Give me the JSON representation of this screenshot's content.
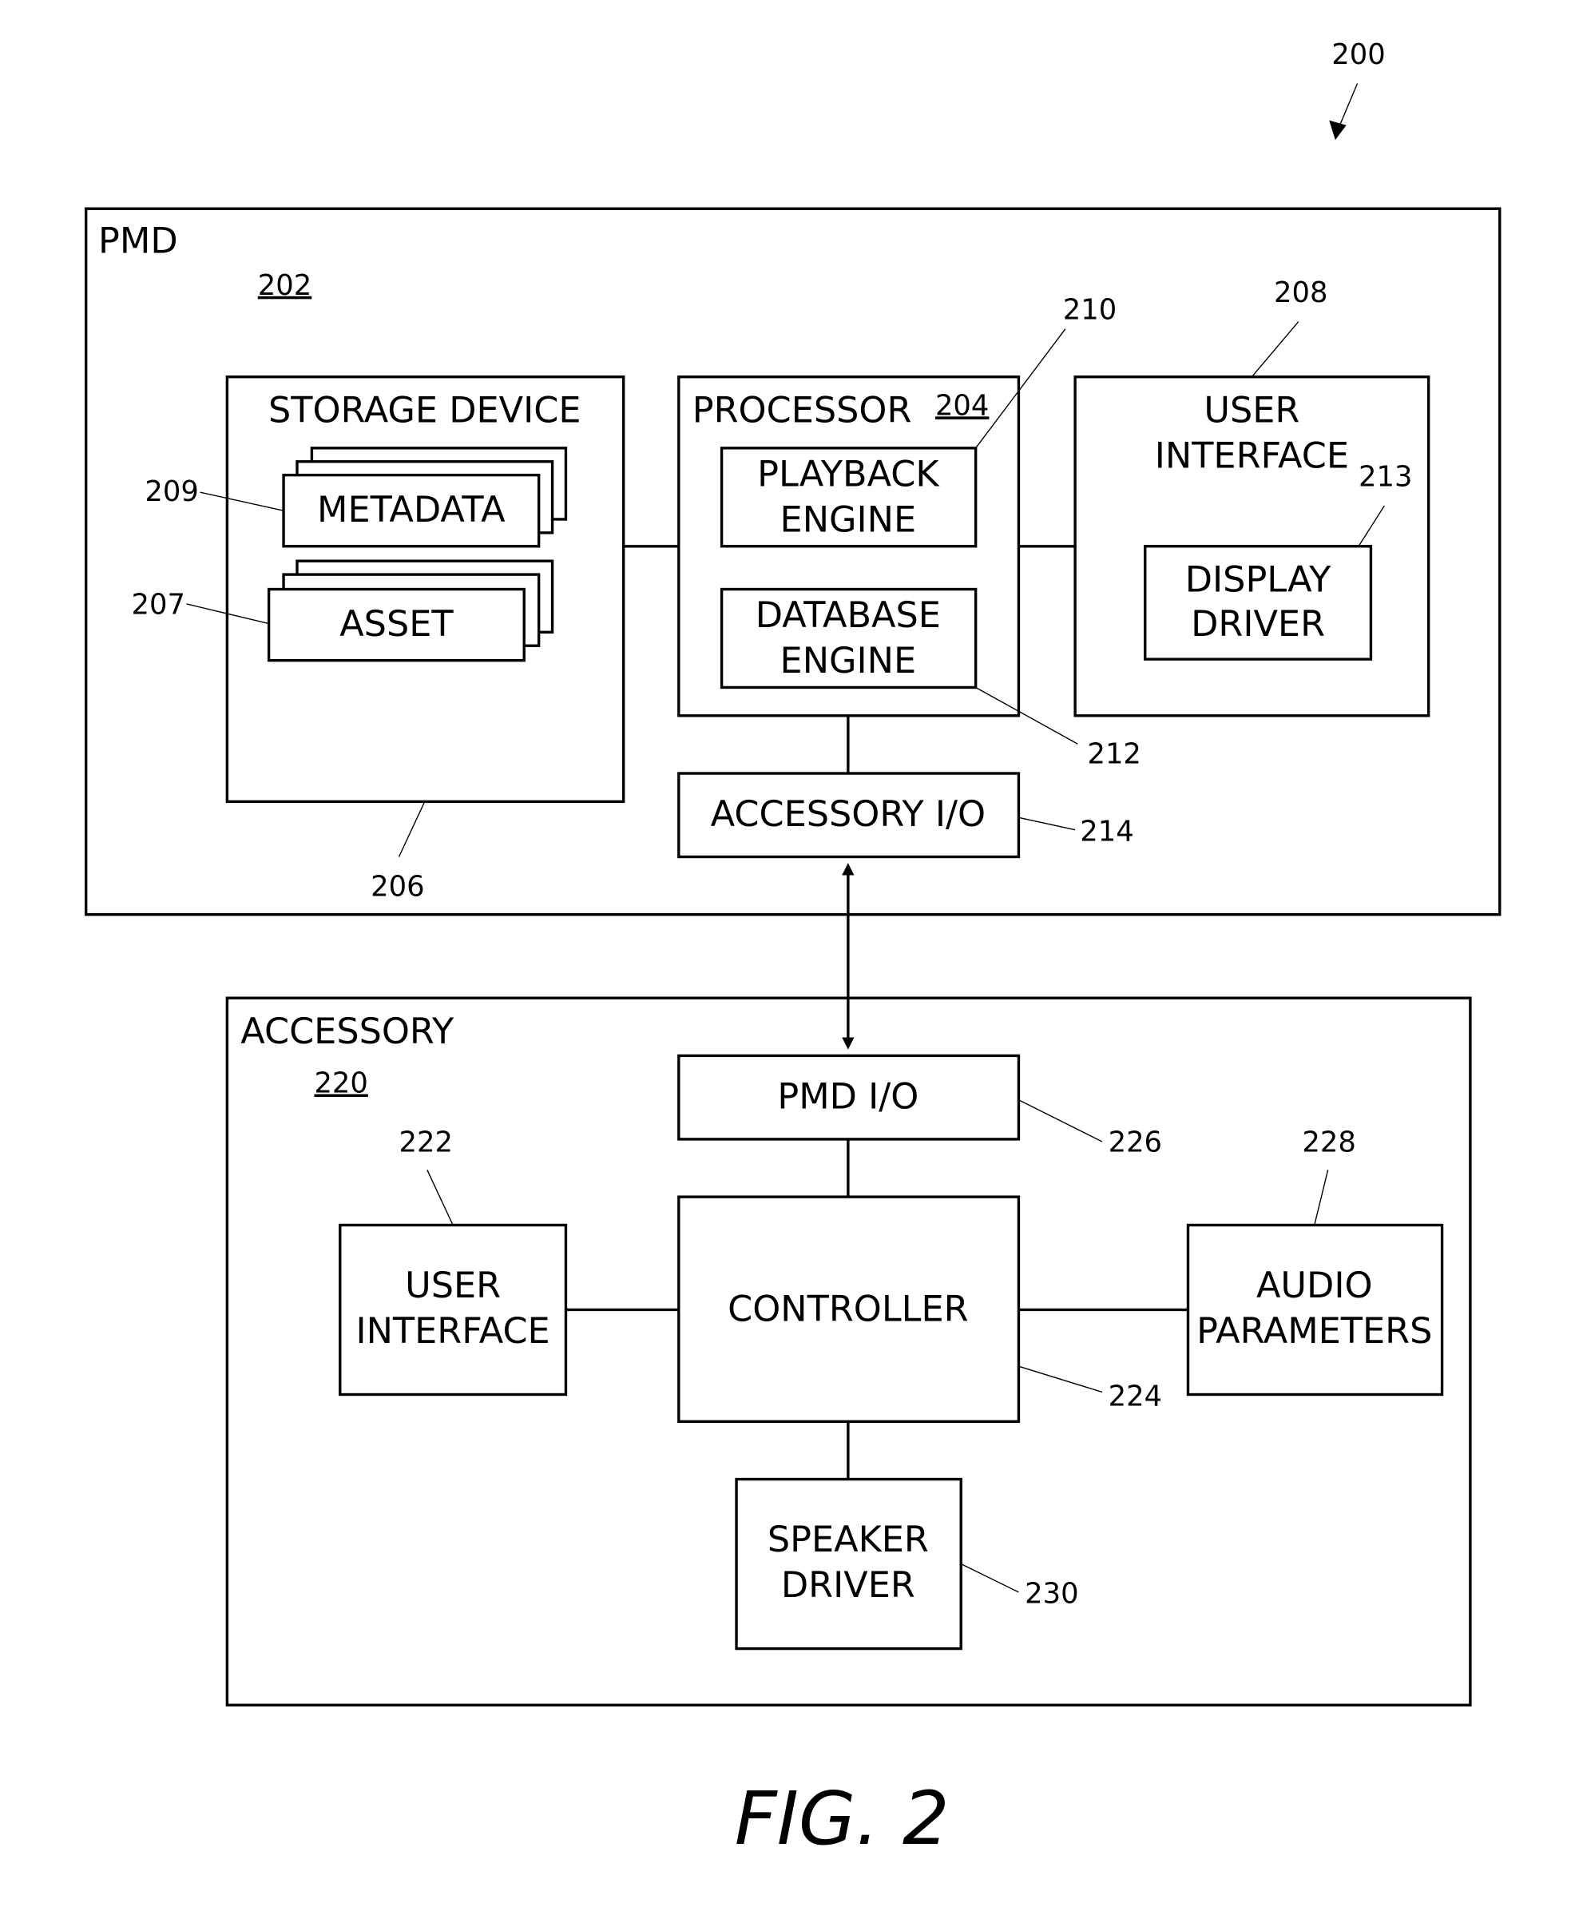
{
  "figure": {
    "caption": "FIG. 2",
    "ref": "200"
  },
  "pmd": {
    "title": "PMD",
    "ref": "202",
    "storage": {
      "title": "STORAGE DEVICE",
      "ref": "206",
      "metadata": {
        "label": "METADATA",
        "ref": "209"
      },
      "asset": {
        "label": "ASSET",
        "ref": "207"
      }
    },
    "processor": {
      "title": "PROCESSOR",
      "ref": "204",
      "playback": {
        "line1": "PLAYBACK",
        "line2": "ENGINE",
        "ref": "210"
      },
      "database": {
        "line1": "DATABASE",
        "line2": "ENGINE",
        "ref": "212"
      }
    },
    "user_interface": {
      "line1": "USER",
      "line2": "INTERFACE",
      "ref": "208",
      "display_driver": {
        "line1": "DISPLAY",
        "line2": "DRIVER",
        "ref": "213"
      }
    },
    "accessory_io": {
      "label": "ACCESSORY I/O",
      "ref": "214"
    }
  },
  "accessory": {
    "title": "ACCESSORY",
    "ref": "220",
    "pmd_io": {
      "label": "PMD I/O",
      "ref": "226"
    },
    "controller": {
      "label": "CONTROLLER",
      "ref": "224"
    },
    "user_interface": {
      "line1": "USER",
      "line2": "INTERFACE",
      "ref": "222"
    },
    "audio_parameters": {
      "line1": "AUDIO",
      "line2": "PARAMETERS",
      "ref": "228"
    },
    "speaker_driver": {
      "line1": "SPEAKER",
      "line2": "DRIVER",
      "ref": "230"
    }
  }
}
